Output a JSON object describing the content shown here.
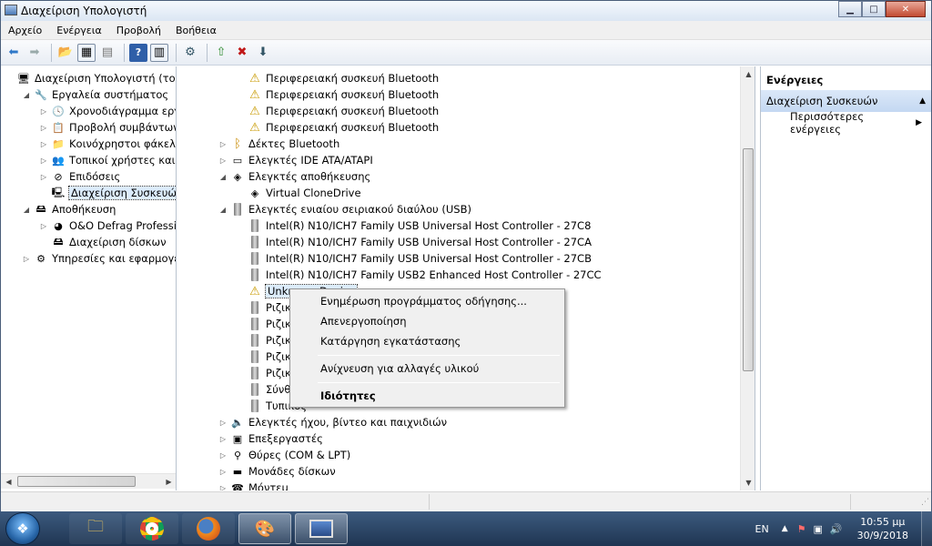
{
  "window": {
    "title": "Διαχείριση Υπολογιστή"
  },
  "window_buttons": {
    "minimize": "▁",
    "maximize": "□",
    "close": "✕"
  },
  "menu": [
    "Αρχείο",
    "Ενέργεια",
    "Προβολή",
    "Βοήθεια"
  ],
  "left_tree": [
    {
      "label": "Διαχείριση Υπολογιστή (τοπικ",
      "icon": "computer-icon",
      "level": 0,
      "exp": ""
    },
    {
      "label": "Εργαλεία συστήματος",
      "icon": "tools-icon",
      "level": 1,
      "exp": "◢"
    },
    {
      "label": "Χρονοδιάγραμμα εργασ",
      "icon": "clock-icon",
      "level": 2,
      "exp": "▷"
    },
    {
      "label": "Προβολή συμβάντων",
      "icon": "event-viewer-icon",
      "level": 2,
      "exp": "▷"
    },
    {
      "label": "Κοινόχρηστοι φάκελοι",
      "icon": "shared-folder-icon",
      "level": 2,
      "exp": "▷"
    },
    {
      "label": "Τοπικοί χρήστες και ομ",
      "icon": "users-icon",
      "level": 2,
      "exp": "▷"
    },
    {
      "label": "Επιδόσεις",
      "icon": "performance-icon",
      "level": 2,
      "exp": "▷"
    },
    {
      "label": "Διαχείριση Συσκευών",
      "icon": "device-manager-icon",
      "level": 2,
      "exp": "",
      "selected": true
    },
    {
      "label": "Αποθήκευση",
      "icon": "storage-icon",
      "level": 1,
      "exp": "◢"
    },
    {
      "label": "O&O Defrag Profession",
      "icon": "defrag-icon",
      "level": 2,
      "exp": "▷"
    },
    {
      "label": "Διαχείριση δίσκων",
      "icon": "disk-management-icon",
      "level": 2,
      "exp": ""
    },
    {
      "label": "Υπηρεσίες και εφαρμογές",
      "icon": "services-icon",
      "level": 1,
      "exp": "▷"
    }
  ],
  "device_tree": [
    {
      "label": "Περιφερειακή συσκευή Bluetooth",
      "icon": "warning-icon",
      "level": 2,
      "exp": ""
    },
    {
      "label": "Περιφερειακή συσκευή Bluetooth",
      "icon": "warning-icon",
      "level": 2,
      "exp": ""
    },
    {
      "label": "Περιφερειακή συσκευή Bluetooth",
      "icon": "warning-icon",
      "level": 2,
      "exp": ""
    },
    {
      "label": "Περιφερειακή συσκευή Bluetooth",
      "icon": "warning-icon",
      "level": 2,
      "exp": ""
    },
    {
      "label": "Δέκτες Bluetooth",
      "icon": "bluetooth-icon",
      "level": 1,
      "exp": "▷"
    },
    {
      "label": "Ελεγκτές IDE ATA/ATAPI",
      "icon": "ide-controller-icon",
      "level": 1,
      "exp": "▷"
    },
    {
      "label": "Ελεγκτές αποθήκευσης",
      "icon": "storage-controller-icon",
      "level": 1,
      "exp": "◢"
    },
    {
      "label": "Virtual CloneDrive",
      "icon": "storage-controller-icon",
      "level": 2,
      "exp": ""
    },
    {
      "label": "Ελεγκτές ενιαίου σειριακού διαύλου (USB)",
      "icon": "usb-icon",
      "level": 1,
      "exp": "◢"
    },
    {
      "label": "Intel(R) N10/ICH7 Family USB Universal Host Controller - 27C8",
      "icon": "usb-icon",
      "level": 2,
      "exp": ""
    },
    {
      "label": "Intel(R) N10/ICH7 Family USB Universal Host Controller - 27CA",
      "icon": "usb-icon",
      "level": 2,
      "exp": ""
    },
    {
      "label": "Intel(R) N10/ICH7 Family USB Universal Host Controller - 27CB",
      "icon": "usb-icon",
      "level": 2,
      "exp": ""
    },
    {
      "label": "Intel(R) N10/ICH7 Family USB2 Enhanced Host Controller - 27CC",
      "icon": "usb-icon",
      "level": 2,
      "exp": ""
    },
    {
      "label": "Unknown Device",
      "icon": "warning-icon",
      "level": 2,
      "exp": "",
      "selected": true
    },
    {
      "label": "Ριζικός",
      "icon": "usb-icon",
      "level": 2,
      "exp": ""
    },
    {
      "label": "Ριζικός",
      "icon": "usb-icon",
      "level": 2,
      "exp": ""
    },
    {
      "label": "Ριζικός",
      "icon": "usb-icon",
      "level": 2,
      "exp": ""
    },
    {
      "label": "Ριζικός",
      "icon": "usb-icon",
      "level": 2,
      "exp": ""
    },
    {
      "label": "Ριζικός",
      "icon": "usb-icon",
      "level": 2,
      "exp": ""
    },
    {
      "label": "Σύνθετη",
      "icon": "usb-icon",
      "level": 2,
      "exp": ""
    },
    {
      "label": "Τυπικός",
      "icon": "usb-icon",
      "level": 2,
      "exp": ""
    },
    {
      "label": "Ελεγκτές ήχου, βίντεο και παιχνιδιών",
      "icon": "speaker-icon",
      "level": 1,
      "exp": "▷"
    },
    {
      "label": "Επεξεργαστές",
      "icon": "processor-icon",
      "level": 1,
      "exp": "▷"
    },
    {
      "label": "Θύρες (COM & LPT)",
      "icon": "port-icon",
      "level": 1,
      "exp": "▷"
    },
    {
      "label": "Μονάδες δίσκων",
      "icon": "disk-drive-icon",
      "level": 1,
      "exp": "▷"
    },
    {
      "label": "Μόντεμ",
      "icon": "modem-icon",
      "level": 1,
      "exp": "▷"
    }
  ],
  "actions": {
    "header": "Ενέργειες",
    "selected": "Διαχείριση Συσκευών",
    "more": "Περισσότερες ενέργειες"
  },
  "context_menu": {
    "update": "Ενημέρωση προγράμματος οδήγησης...",
    "disable": "Απενεργοποίηση",
    "uninstall": "Κατάργηση εγκατάστασης",
    "scan": "Ανίχνευση για αλλαγές υλικού",
    "properties": "Ιδιότητες"
  },
  "taskbar": {
    "language": "EN",
    "time": "10:55 μμ",
    "date": "30/9/2018",
    "apps": [
      "explorer-icon",
      "chrome-icon",
      "firefox-icon",
      "paint-icon",
      "computer-management-icon"
    ]
  }
}
